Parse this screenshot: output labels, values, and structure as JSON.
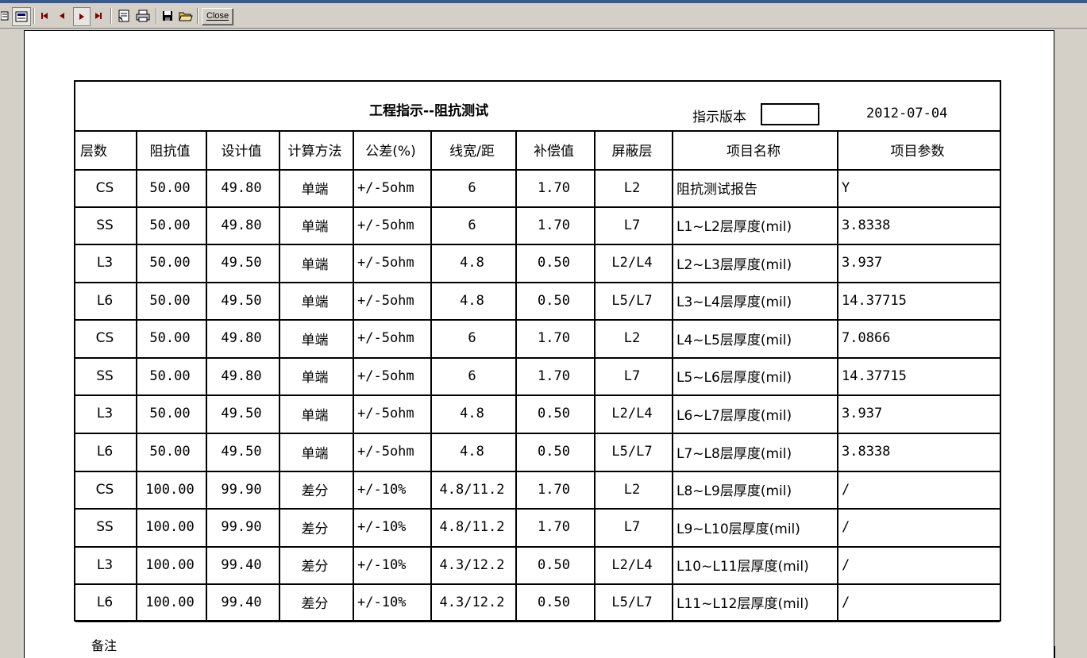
{
  "toolbar": {
    "close_label": "Close",
    "icons": [
      "toc-icon",
      "export-icon",
      "first-page-icon",
      "prev-page-icon",
      "next-page-icon",
      "last-page-icon",
      "refresh-icon",
      "print-icon",
      "save-icon",
      "open-icon"
    ]
  },
  "report": {
    "title": "工程指示--阻抗测试",
    "version_label": "指示版本",
    "version_value": "",
    "date": "2012-07-04",
    "columns": [
      "层数",
      "阻抗值",
      "设计值",
      "计算方法",
      "公差(%)",
      "线宽/距",
      "补偿值",
      "屏蔽层",
      "项目名称",
      "项目参数"
    ],
    "rows": [
      [
        "CS",
        "50.00",
        "49.80",
        "单端",
        "+/-5ohm",
        "6",
        "1.70",
        "L2",
        "阻抗测试报告",
        "Y"
      ],
      [
        "SS",
        "50.00",
        "49.80",
        "单端",
        "+/-5ohm",
        "6",
        "1.70",
        "L7",
        "L1~L2层厚度(mil)",
        "3.8338"
      ],
      [
        "L3",
        "50.00",
        "49.50",
        "单端",
        "+/-5ohm",
        "4.8",
        "0.50",
        "L2/L4",
        "L2~L3层厚度(mil)",
        "3.937"
      ],
      [
        "L6",
        "50.00",
        "49.50",
        "单端",
        "+/-5ohm",
        "4.8",
        "0.50",
        "L5/L7",
        "L3~L4层厚度(mil)",
        "14.37715"
      ],
      [
        "CS",
        "50.00",
        "49.80",
        "单端",
        "+/-5ohm",
        "6",
        "1.70",
        "L2",
        "L4~L5层厚度(mil)",
        "7.0866"
      ],
      [
        "SS",
        "50.00",
        "49.80",
        "单端",
        "+/-5ohm",
        "6",
        "1.70",
        "L7",
        "L5~L6层厚度(mil)",
        "14.37715"
      ],
      [
        "L3",
        "50.00",
        "49.50",
        "单端",
        "+/-5ohm",
        "4.8",
        "0.50",
        "L2/L4",
        "L6~L7层厚度(mil)",
        "3.937"
      ],
      [
        "L6",
        "50.00",
        "49.50",
        "单端",
        "+/-5ohm",
        "4.8",
        "0.50",
        "L5/L7",
        "L7~L8层厚度(mil)",
        " 3.8338"
      ],
      [
        "CS",
        "100.00",
        "99.90",
        "差分",
        "+/-10%",
        "4.8/11.2",
        "1.70",
        "L2",
        "L8~L9层厚度(mil)",
        "/"
      ],
      [
        "SS",
        "100.00",
        "99.90",
        "差分",
        "+/-10%",
        "4.8/11.2",
        "1.70",
        "L7",
        "L9~L10层厚度(mil)",
        "/"
      ],
      [
        "L3",
        "100.00",
        "99.40",
        "差分",
        "+/-10%",
        "4.3/12.2",
        "0.50",
        "L2/L4",
        "L10~L11层厚度(mil)",
        "/"
      ],
      [
        "L6",
        "100.00",
        "99.40",
        "差分",
        "+/-10%",
        "4.3/12.2",
        "0.50",
        "L5/L7",
        "L11~L12层厚度(mil)",
        "/"
      ]
    ],
    "note_label": "备注"
  }
}
